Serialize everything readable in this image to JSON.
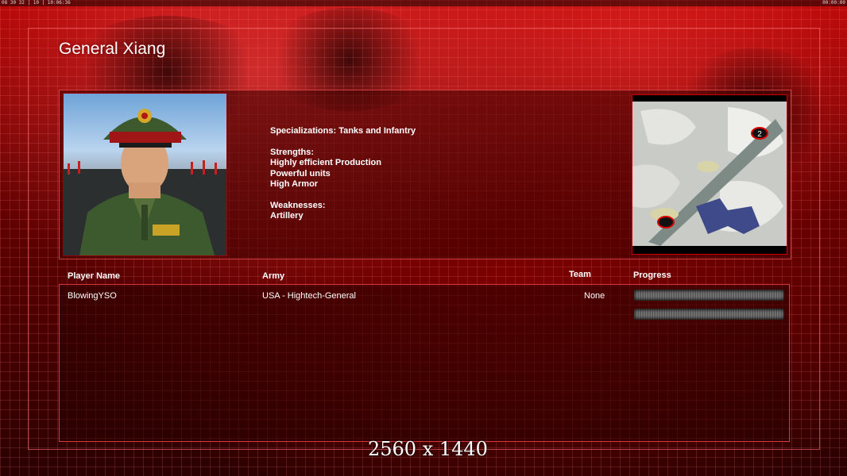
{
  "topbar": {
    "left": "08 30 32 | 10 | 10:06:36",
    "right": "00:00:00"
  },
  "general_title": "General Xiang",
  "description": {
    "specializations": "Specializations: Tanks and Infantry",
    "strengths_header": "Strengths:",
    "strengths": [
      "Highly efficient Production",
      "Powerful units",
      "High Armor"
    ],
    "weaknesses_header": "Weaknesses:",
    "weaknesses": [
      "Artillery"
    ]
  },
  "minimap": {
    "start_marker_label": "2"
  },
  "table": {
    "headers": {
      "player": "Player Name",
      "army": "Army",
      "team": "Team",
      "progress": "Progress"
    },
    "rows": [
      {
        "player": "BlowingYSO",
        "army": "USA - Hightech-General",
        "team": "None",
        "progress": null
      }
    ]
  },
  "resolution_label": "2560 x 1440",
  "colors": {
    "theme_red": "#b30000",
    "panel_border": "#ff5a5a"
  }
}
